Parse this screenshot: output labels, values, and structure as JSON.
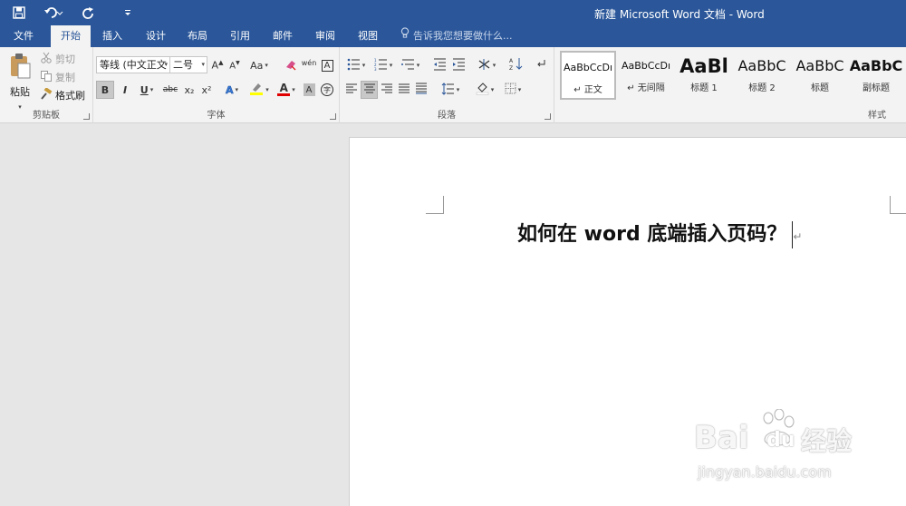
{
  "titlebar": {
    "document_title": "新建 Microsoft Word 文档 - Word",
    "qat": {
      "save_icon": "save-icon",
      "undo_icon": "undo-icon",
      "redo_icon": "redo-icon",
      "customize_icon": "customize-qat-icon"
    },
    "color": "#2b579a"
  },
  "tabs": [
    {
      "label": "文件"
    },
    {
      "label": "开始"
    },
    {
      "label": "插入"
    },
    {
      "label": "设计"
    },
    {
      "label": "布局"
    },
    {
      "label": "引用"
    },
    {
      "label": "邮件"
    },
    {
      "label": "审阅"
    },
    {
      "label": "视图"
    }
  ],
  "active_tab": "开始",
  "tell_me": {
    "placeholder": "告诉我您想要做什么...",
    "icon": "lightbulb-icon"
  },
  "ribbon": {
    "clipboard": {
      "label": "剪贴板",
      "paste": "粘贴",
      "cut": "剪切",
      "copy": "复制",
      "format_painter": "格式刷"
    },
    "font": {
      "label": "字体",
      "font_name": "等线 (中文正文",
      "font_size": "二号",
      "change_case": "Aa",
      "phonetic": "wén",
      "bold": "B",
      "italic": "I",
      "underline": "U",
      "strikethrough": "abc",
      "subscript": "x₂",
      "superscript": "x²",
      "highlight_color": "#ffff00",
      "font_color": "#e00000"
    },
    "paragraph": {
      "label": "段落"
    },
    "styles": {
      "label": "样式",
      "items": [
        {
          "preview": "AaBbCcDı",
          "name": "↵ 正文",
          "selected": true
        },
        {
          "preview": "AaBbCcDı",
          "name": "↵ 无间隔",
          "selected": false
        },
        {
          "preview": "AaBl",
          "name": "标题 1",
          "selected": false
        },
        {
          "preview": "AaBbC",
          "name": "标题 2",
          "selected": false
        },
        {
          "preview": "AaBbC",
          "name": "标题",
          "selected": false
        },
        {
          "preview": "AaBbC",
          "name": "副标题",
          "selected": false
        }
      ]
    }
  },
  "document": {
    "text": "如何在 word 底端插入页码？",
    "paragraph_mark": "↵"
  },
  "watermark": {
    "brand": "Bai",
    "brand2": "du",
    "cn": "经验",
    "url": "jingyan.baidu.com"
  }
}
